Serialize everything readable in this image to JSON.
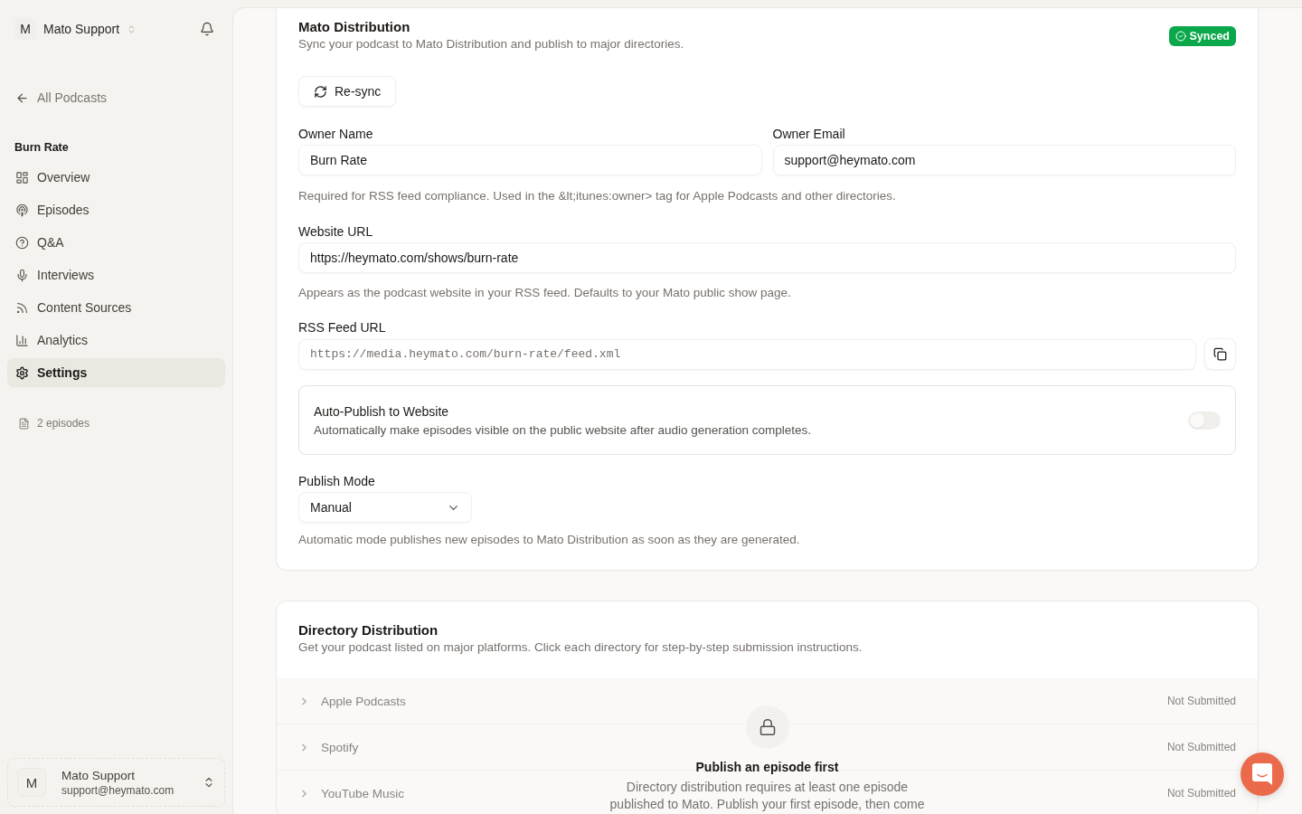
{
  "sidebar": {
    "workspace": {
      "avatar": "M",
      "name": "Mato Support"
    },
    "back_link": "All Podcasts",
    "section_title": "Burn Rate",
    "nav_items": [
      {
        "label": "Overview",
        "selected": false
      },
      {
        "label": "Episodes",
        "selected": false
      },
      {
        "label": "Q&A",
        "selected": false
      },
      {
        "label": "Interviews",
        "selected": false
      },
      {
        "label": "Content Sources",
        "selected": false
      },
      {
        "label": "Analytics",
        "selected": false
      },
      {
        "label": "Settings",
        "selected": true
      }
    ],
    "episode_count": "2 episodes",
    "user": {
      "avatar": "M",
      "name": "Mato Support",
      "email": "support@heymato.com"
    }
  },
  "mato_distribution": {
    "title": "Mato Distribution",
    "description": "Sync your podcast to Mato Distribution and publish to major directories.",
    "status_badge": "Synced",
    "resync_button": "Re-sync",
    "owner_name": {
      "label": "Owner Name",
      "value": "Burn Rate"
    },
    "owner_email": {
      "label": "Owner Email",
      "value": "support@heymato.com"
    },
    "owner_help": "Required for RSS feed compliance. Used in the &lt;itunes:owner> tag for Apple Podcasts and other directories.",
    "website_url": {
      "label": "Website URL",
      "value": "https://heymato.com/shows/burn-rate",
      "help": "Appears as the podcast website in your RSS feed. Defaults to your Mato public show page."
    },
    "rss_feed_url": {
      "label": "RSS Feed URL",
      "value": "https://media.heymato.com/burn-rate/feed.xml"
    },
    "auto_publish": {
      "title": "Auto-Publish to Website",
      "description": "Automatically make episodes visible on the public website after audio generation completes.",
      "on": false
    },
    "publish_mode": {
      "label": "Publish Mode",
      "value": "Manual",
      "help": "Automatic mode publishes new episodes to Mato Distribution as soon as they are generated."
    }
  },
  "directory_distribution": {
    "title": "Directory Distribution",
    "description": "Get your podcast listed on major platforms. Click each directory for step-by-step submission instructions.",
    "directories": [
      {
        "name": "Apple Podcasts",
        "status": "Not Submitted"
      },
      {
        "name": "Spotify",
        "status": "Not Submitted"
      },
      {
        "name": "YouTube Music",
        "status": "Not Submitted"
      }
    ],
    "locked_notice": {
      "title": "Publish an episode first",
      "description": "Directory distribution requires at least one episode published to Mato. Publish your first episode, then come"
    }
  }
}
